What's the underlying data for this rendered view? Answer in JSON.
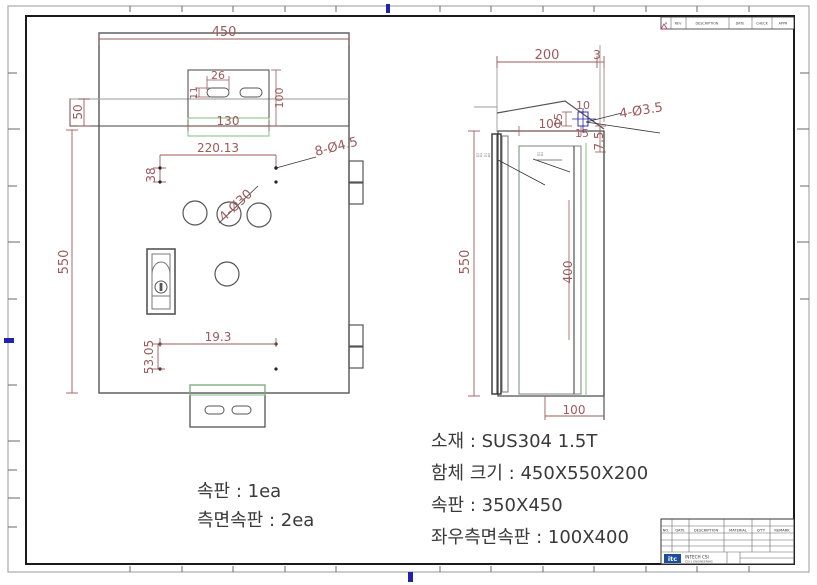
{
  "sheet": {
    "background_color": "#ffffff",
    "border_color": "#1a1a1a",
    "dim_color": "#9c5a5a",
    "part_color": "#555555",
    "green_color": "#7fbf7f",
    "blue_color": "#2222aa",
    "note_color": "#3a3a3a"
  },
  "views": {
    "front": {
      "name": "front-panel-view",
      "dimensions": {
        "overall_width": "450",
        "overall_height": "550",
        "top_offset": "50",
        "slot_plate_width": "130",
        "slot_plate_height": "100",
        "slot_width": "26",
        "slot_height": "11",
        "hole_pitch_h": "220.13",
        "hole_pitch_v": "38",
        "bottom_pitch_h": "19.3",
        "bottom_pitch_v": "53.05"
      },
      "callouts": {
        "small_holes": "8-Ø4.5",
        "large_holes": "4-Ø30"
      }
    },
    "side": {
      "name": "side-section-view",
      "dimensions": {
        "depth": "200",
        "flange": "3",
        "detail_10": "10",
        "detail_15a": "15",
        "detail_15b": "15",
        "inner_top": "100",
        "edge_7_5": "7.5",
        "overall_height": "550",
        "inner_plate_height": "400",
        "bottom_width": "100"
      },
      "callouts": {
        "screw_holes": "4-Ø3.5"
      }
    }
  },
  "notes_left": {
    "name": "quantity-notes",
    "lines": [
      "속판 :  1ea",
      "측면속판 :  2ea"
    ],
    "line1": "속판 :  1ea",
    "line2": "측면속판 :  2ea"
  },
  "notes_right": {
    "name": "specification-notes",
    "line1": "소재 :  SUS304    1.5T",
    "line2": "함체 크기 :  450X550X200",
    "line3": "속판 :  350X450",
    "line4": "좌우측면속판 :  100X400"
  },
  "title_block": {
    "name": "title-block",
    "columns": [
      "NO.",
      "DATE",
      "DESCRIPTION",
      "MATERIAL",
      "Q'TY",
      "REMARK"
    ],
    "logo_text": "itc",
    "company": "INTECH CSI",
    "company_sub": "CSI-1 ENGINEERING"
  },
  "revision_block": {
    "name": "revision-block",
    "columns": [
      "A",
      "REV",
      "DESCRIPTION",
      "DATE",
      "CHECK",
      "APPR"
    ]
  }
}
